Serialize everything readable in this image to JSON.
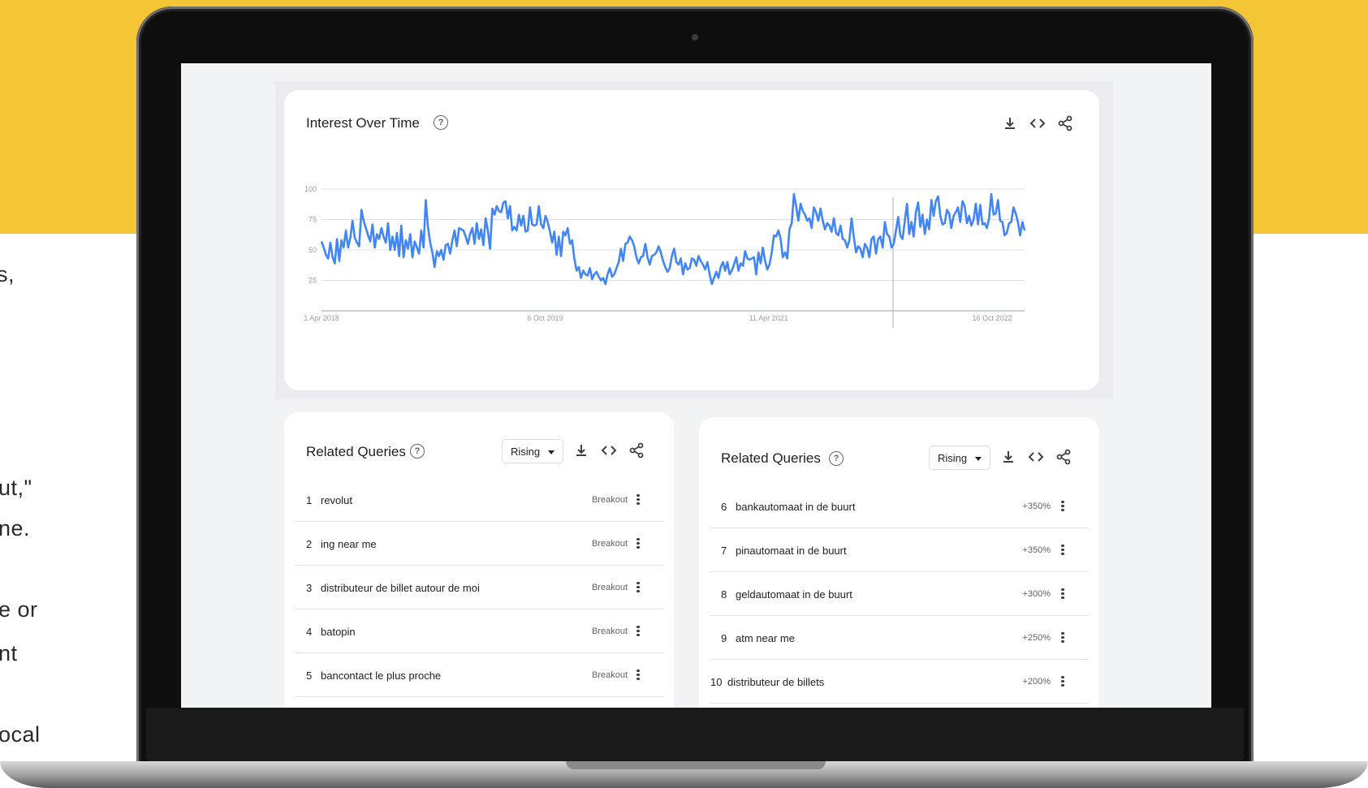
{
  "side_text": [
    "s,",
    "ut,\"",
    "ne.",
    "e or",
    "nt",
    "ocal"
  ],
  "interest_over_time": {
    "title": "Interest Over Time",
    "help_icon": "help-circle-icon",
    "toolbar_icons": [
      "download-icon",
      "embed-code-icon",
      "share-icon"
    ],
    "chart_data": {
      "type": "line",
      "y_ticks": [
        "100",
        "75",
        "50",
        "25"
      ],
      "x_tick_labels": [
        "1 Apr 2018",
        "6 Oct 2019",
        "11 Apr 2021",
        "16 Oct 2022"
      ],
      "ylim": [
        0,
        100
      ],
      "grid": true,
      "series_color": "#4285f4",
      "x": "weekly, 2018-04-01 to 2023-03",
      "values": [
        57,
        52,
        46,
        43,
        56,
        44,
        39,
        59,
        41,
        58,
        52,
        66,
        52,
        60,
        74,
        60,
        56,
        53,
        83,
        74,
        68,
        62,
        57,
        71,
        52,
        63,
        59,
        68,
        61,
        56,
        72,
        50,
        61,
        50,
        64,
        45,
        70,
        44,
        58,
        51,
        63,
        44,
        57,
        52,
        47,
        66,
        52,
        91,
        69,
        56,
        48,
        36,
        49,
        45,
        50,
        42,
        54,
        55,
        47,
        58,
        66,
        53,
        68,
        67,
        66,
        61,
        55,
        63,
        68,
        55,
        72,
        59,
        67,
        54,
        76,
        66,
        51,
        84,
        79,
        86,
        82,
        81,
        89,
        90,
        76,
        86,
        66,
        69,
        66,
        79,
        70,
        78,
        65,
        66,
        85,
        71,
        70,
        71,
        86,
        71,
        68,
        78,
        73,
        65,
        56,
        65,
        46,
        61,
        45,
        65,
        62,
        68,
        55,
        58,
        43,
        33,
        36,
        27,
        33,
        30,
        29,
        35,
        26,
        30,
        32,
        28,
        25,
        27,
        22,
        30,
        35,
        28,
        30,
        35,
        40,
        51,
        41,
        55,
        56,
        61,
        58,
        53,
        44,
        39,
        44,
        45,
        55,
        44,
        38,
        45,
        46,
        48,
        53,
        48,
        41,
        36,
        32,
        35,
        45,
        51,
        40,
        38,
        43,
        30,
        39,
        34,
        35,
        43,
        42,
        37,
        45,
        41,
        38,
        34,
        40,
        30,
        22,
        27,
        32,
        27,
        36,
        40,
        33,
        40,
        30,
        33,
        38,
        44,
        33,
        39,
        37,
        49,
        43,
        42,
        43,
        44,
        30,
        48,
        39,
        52,
        41,
        34,
        38,
        48,
        62,
        61,
        66,
        59,
        44,
        48,
        43,
        67,
        72,
        96,
        86,
        74,
        88,
        82,
        79,
        74,
        76,
        68,
        85,
        81,
        74,
        84,
        74,
        67,
        72,
        70,
        65,
        76,
        64,
        62,
        70,
        59,
        58,
        52,
        58,
        76,
        61,
        48,
        53,
        51,
        44,
        55,
        52,
        44,
        59,
        61,
        47,
        59,
        61,
        52,
        73,
        63,
        61,
        52,
        55,
        66,
        77,
        62,
        59,
        74,
        88,
        63,
        73,
        61,
        81,
        89,
        69,
        79,
        63,
        75,
        67,
        91,
        78,
        90,
        94,
        78,
        71,
        72,
        83,
        80,
        68,
        78,
        81,
        85,
        73,
        90,
        86,
        72,
        78,
        70,
        75,
        88,
        71,
        87,
        71,
        72,
        68,
        76,
        96,
        79,
        80,
        91,
        74,
        73,
        62,
        64,
        72,
        73,
        85,
        80,
        73,
        62,
        73,
        66
      ]
    }
  },
  "related_queries_left": {
    "title": "Related Queries",
    "filter_label": "Rising",
    "toolbar_icons": [
      "download-icon",
      "embed-code-icon",
      "share-icon"
    ],
    "rows": [
      {
        "index": "1",
        "query": "revolut",
        "value": "Breakout"
      },
      {
        "index": "2",
        "query": "ing near me",
        "value": "Breakout"
      },
      {
        "index": "3",
        "query": "distributeur de billet autour de moi",
        "value": "Breakout"
      },
      {
        "index": "4",
        "query": "batopin",
        "value": "Breakout"
      },
      {
        "index": "5",
        "query": "bancontact le plus proche",
        "value": "Breakout"
      }
    ]
  },
  "related_queries_right": {
    "title": "Related Queries",
    "filter_label": "Rising",
    "toolbar_icons": [
      "download-icon",
      "embed-code-icon",
      "share-icon"
    ],
    "rows": [
      {
        "index": "6",
        "query": "bankautomaat in de buurt",
        "value": "+350%"
      },
      {
        "index": "7",
        "query": "pinautomaat in de buurt",
        "value": "+350%"
      },
      {
        "index": "8",
        "query": "geldautomaat in de buurt",
        "value": "+300%"
      },
      {
        "index": "9",
        "query": "atm near me",
        "value": "+250%"
      },
      {
        "index": "10",
        "query": "distributeur de billets",
        "value": "+200%"
      }
    ]
  }
}
